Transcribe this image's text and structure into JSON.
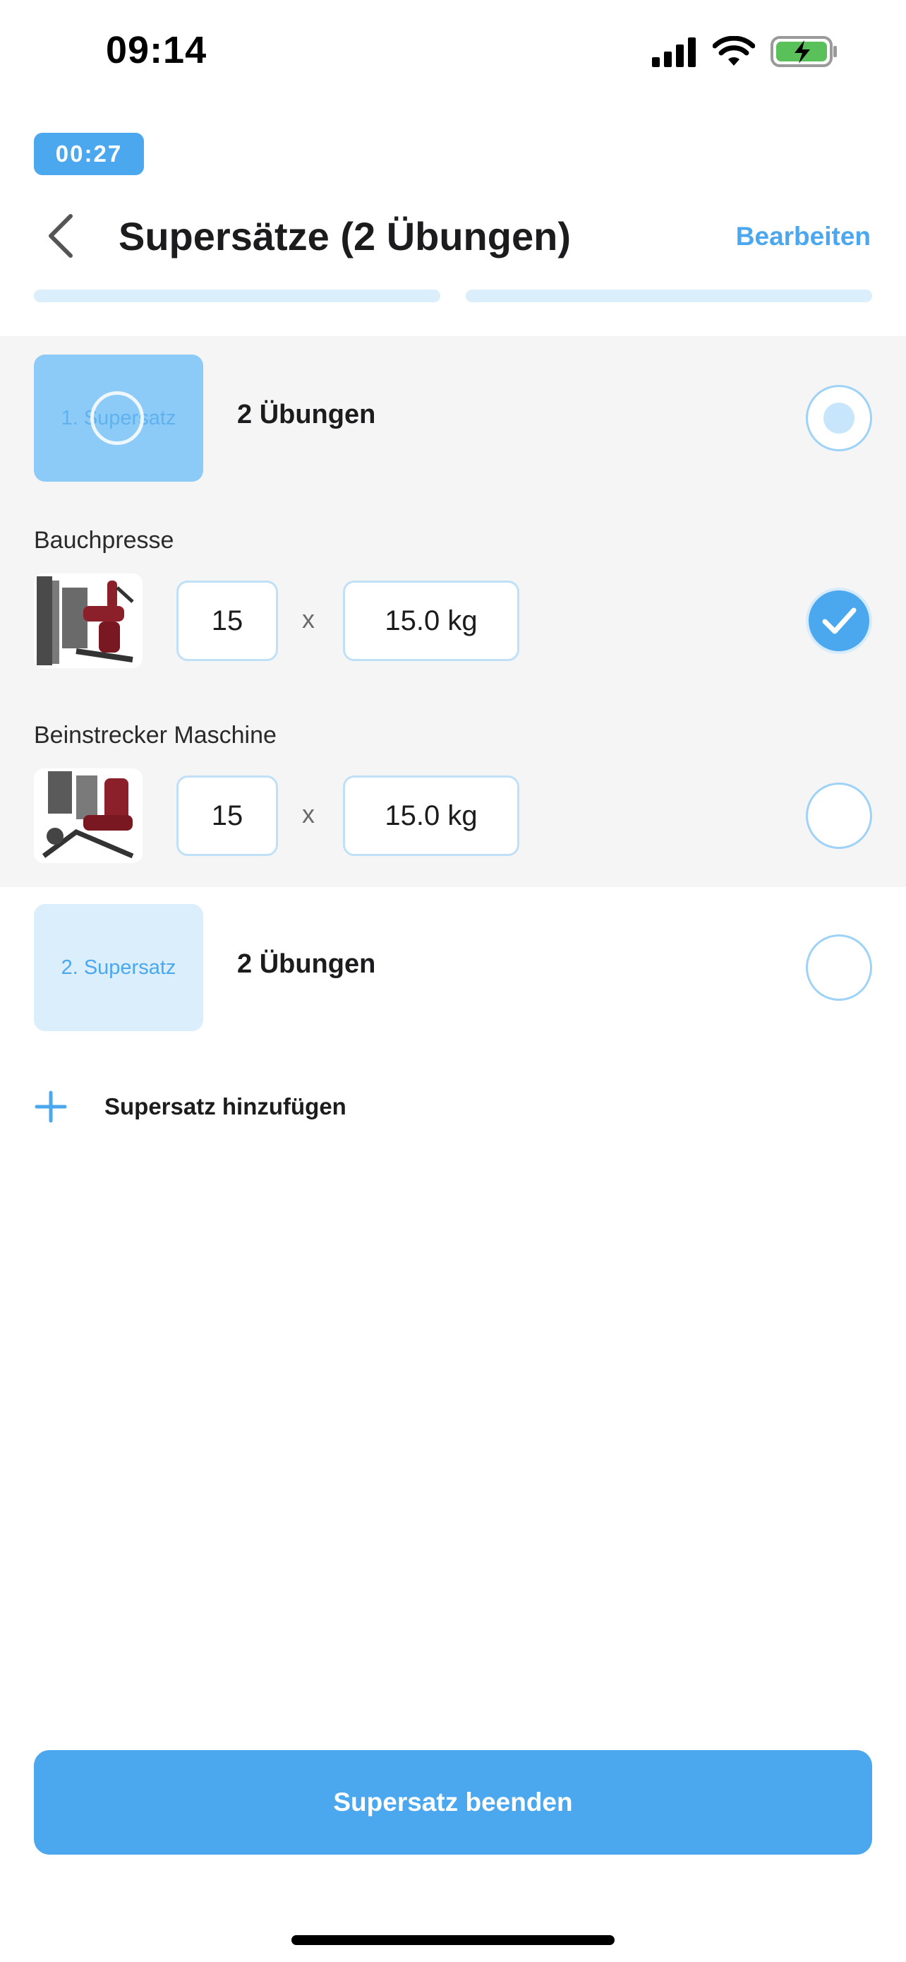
{
  "status_bar": {
    "time": "09:14"
  },
  "timer": "00:27",
  "header": {
    "title": "Supersätze (2 Übungen)",
    "edit_label": "Bearbeiten"
  },
  "supersets": [
    {
      "label": "1. Supersatz",
      "count": "2 Übungen",
      "state": "active",
      "exercises": [
        {
          "name": "Bauchpresse",
          "reps": "15",
          "times": "x",
          "weight": "15.0 kg",
          "done": true
        },
        {
          "name": "Beinstrecker Maschine",
          "reps": "15",
          "times": "x",
          "weight": "15.0 kg",
          "done": false
        }
      ]
    },
    {
      "label": "2. Supersatz",
      "count": "2 Übungen",
      "state": "inactive"
    }
  ],
  "add_superset_label": "Supersatz hinzufügen",
  "finish_button_label": "Supersatz beenden",
  "colors": {
    "accent": "#4ba7ee",
    "light_accent": "#dbeefb",
    "group_background": "#f5f5f5"
  }
}
